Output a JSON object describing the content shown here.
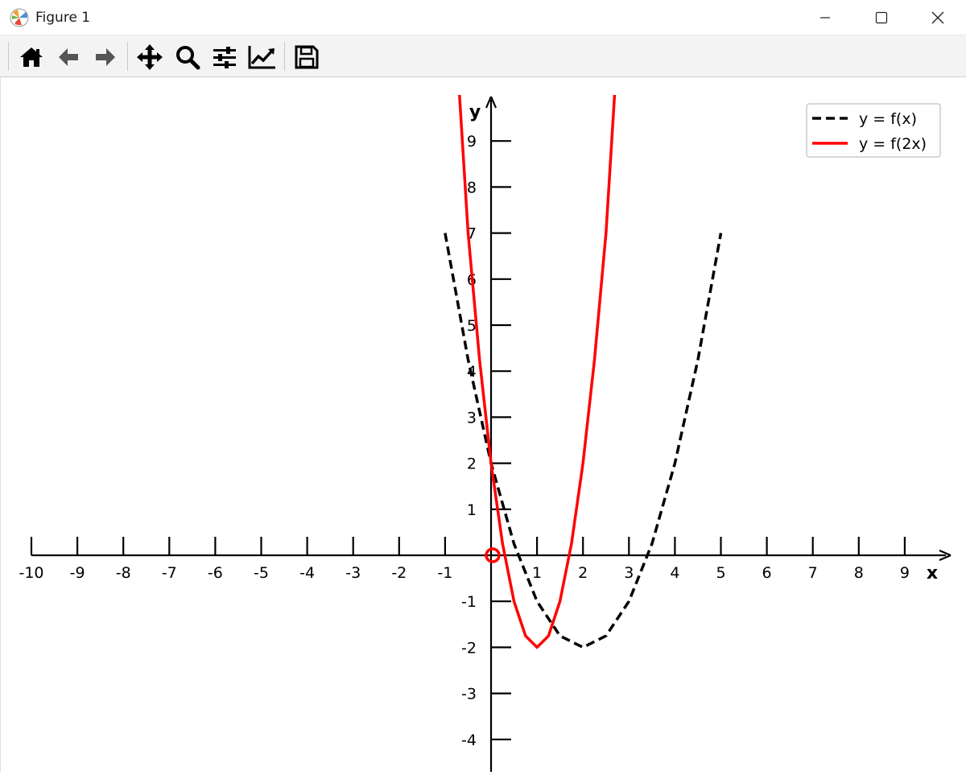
{
  "window": {
    "title": "Figure 1",
    "app_icon": "matplotlib-logo-icon",
    "controls": [
      "minimize-icon",
      "maximize-icon",
      "close-icon"
    ]
  },
  "toolbar": {
    "buttons": [
      {
        "name": "home",
        "icon": "home-icon"
      },
      {
        "name": "back",
        "icon": "arrow-left-icon"
      },
      {
        "name": "forward",
        "icon": "arrow-right-icon"
      },
      {
        "name": "pan",
        "icon": "move-arrows-icon"
      },
      {
        "name": "zoom",
        "icon": "magnifier-icon"
      },
      {
        "name": "configure-subplots",
        "icon": "sliders-icon"
      },
      {
        "name": "edit-axis",
        "icon": "line-chart-icon"
      },
      {
        "name": "save",
        "icon": "floppy-disk-icon"
      }
    ]
  },
  "chart_data": {
    "type": "line",
    "xlabel": "x",
    "ylabel": "y",
    "xlim": [
      -10,
      9.5
    ],
    "ylim": [
      -4.5,
      10
    ],
    "x_ticks": [
      "-10",
      "-9",
      "-8",
      "-7",
      "-6",
      "-5",
      "-4",
      "-3",
      "-2",
      "-1",
      "1",
      "2",
      "3",
      "4",
      "5",
      "6",
      "7",
      "8",
      "9"
    ],
    "y_ticks": [
      "-4",
      "-3",
      "-2",
      "-1",
      "1",
      "2",
      "3",
      "4",
      "5",
      "6",
      "7",
      "8",
      "9"
    ],
    "spines": "centered-at-origin-with-arrows",
    "grid": false,
    "legend_position": "top-right",
    "series": [
      {
        "name": "y = f(x)",
        "style": "dashed",
        "color": "#000000",
        "x": [
          -1,
          -0.5,
          0,
          0.5,
          1,
          1.5,
          2,
          2.5,
          3,
          3.5,
          4,
          4.5,
          5
        ],
        "y": [
          7,
          4.25,
          2,
          0.25,
          -1,
          -1.75,
          -2,
          -1.75,
          -1,
          0.25,
          2,
          4.25,
          7
        ]
      },
      {
        "name": "y = f(2x)",
        "style": "solid",
        "color": "#ff0000",
        "x": [
          -0.75,
          -0.5,
          -0.25,
          0,
          0.25,
          0.5,
          0.75,
          1,
          1.25,
          1.5,
          1.75,
          2,
          2.25,
          2.5,
          2.75
        ],
        "y": [
          11,
          7,
          4.25,
          2,
          0.25,
          -1,
          -1.75,
          -2,
          -1.75,
          -1,
          0.25,
          2,
          4.25,
          7,
          11
        ]
      }
    ],
    "markers": [
      {
        "x": 0,
        "y": 0,
        "shape": "open-circle",
        "color": "#ff0000"
      }
    ]
  }
}
